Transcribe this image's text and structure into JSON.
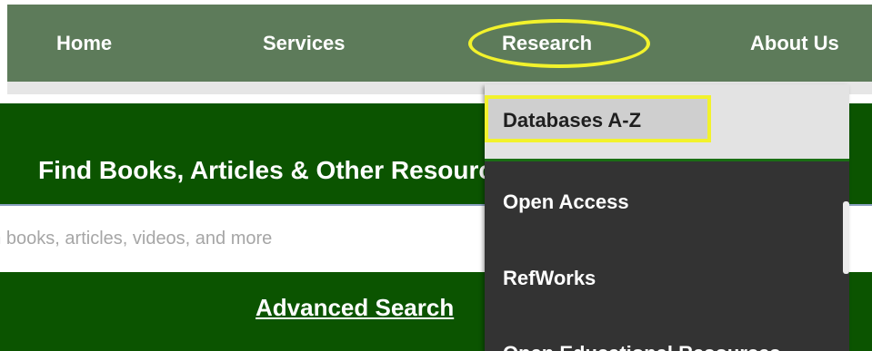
{
  "nav": {
    "items": [
      {
        "label": "Home"
      },
      {
        "label": "Services"
      },
      {
        "label": "Research"
      },
      {
        "label": "About Us"
      }
    ]
  },
  "hero": {
    "title": "Find Books, Articles & Other Resources",
    "search_placeholder": "Search books, articles, videos, and more",
    "advanced_search": "Advanced Search"
  },
  "dropdown": {
    "items": [
      {
        "label": "Databases A-Z"
      },
      {
        "label": "Open Access"
      },
      {
        "label": "RefWorks"
      },
      {
        "label": "Open Educational Resources"
      }
    ]
  },
  "colors": {
    "nav_bg": "#5d7b5a",
    "hero_bg": "#0b5400",
    "dropdown_bg": "#333333",
    "highlight": "#f2f22c"
  }
}
